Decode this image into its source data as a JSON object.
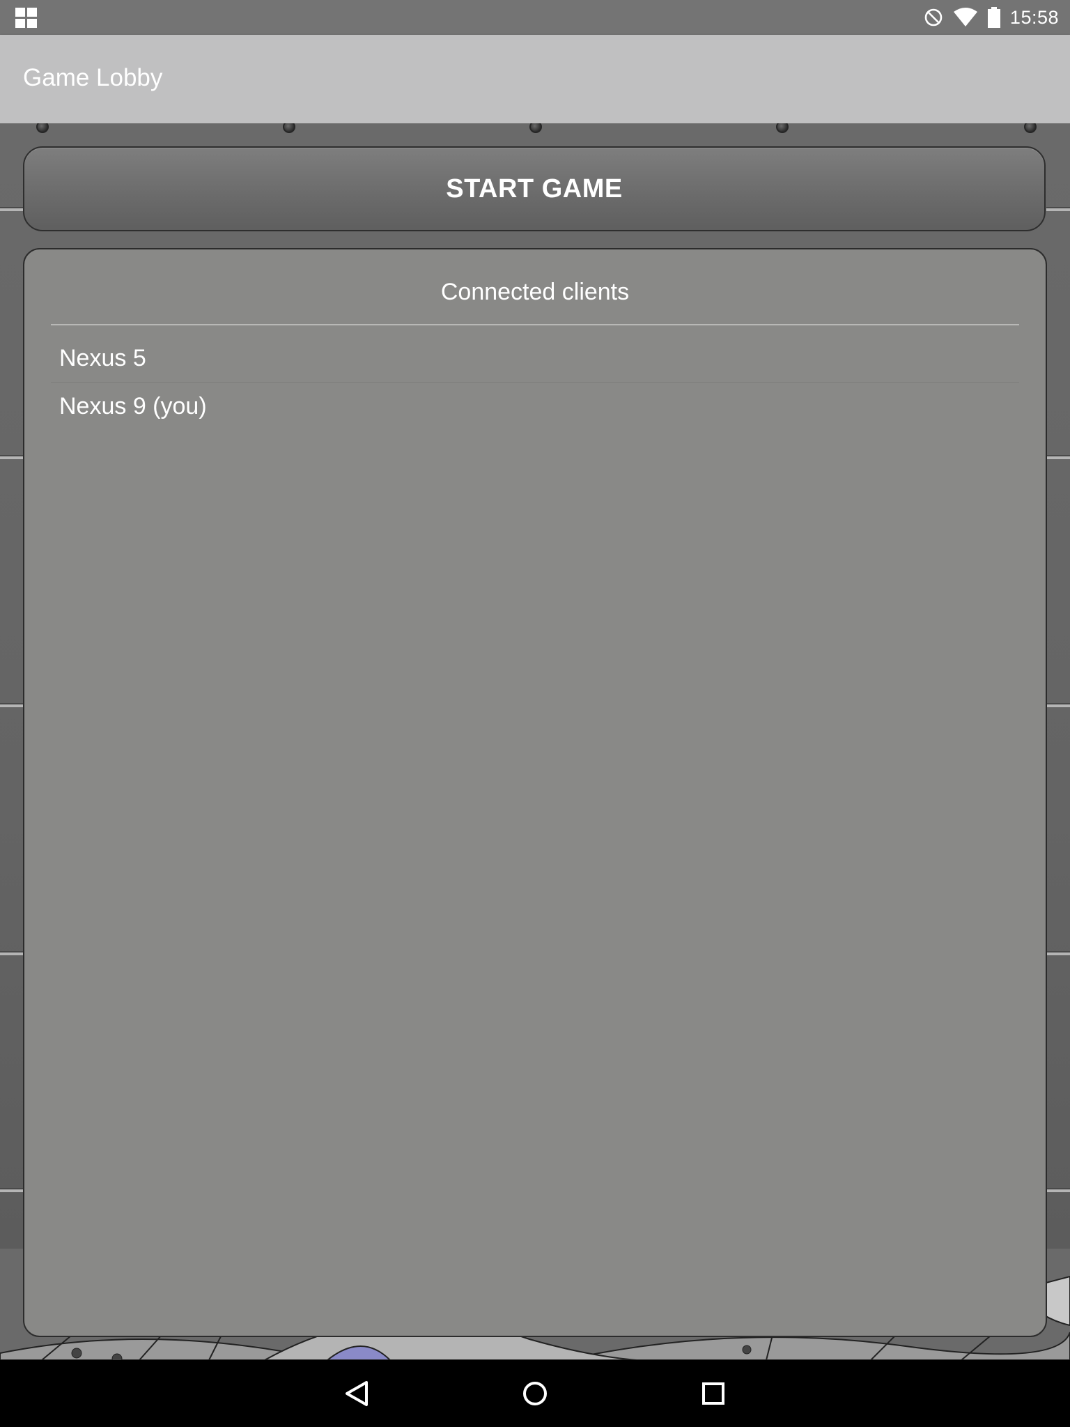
{
  "status_bar": {
    "time": "15:58",
    "icons": [
      "apps-grid-icon",
      "do-not-disturb-icon",
      "wifi-icon",
      "battery-icon"
    ]
  },
  "app_bar": {
    "title": "Game Lobby"
  },
  "start_button": {
    "label": "START GAME"
  },
  "clients_panel": {
    "title": "Connected clients",
    "clients": [
      {
        "name": "Nexus 5"
      },
      {
        "name": "Nexus 9 (you)"
      }
    ]
  },
  "nav_bar": {
    "buttons": [
      "back-icon",
      "home-icon",
      "recents-icon"
    ]
  },
  "colors": {
    "status_bar": "#747474",
    "app_bar": "#c0c0c1",
    "panel": "#898987",
    "text": "#ffffff"
  }
}
